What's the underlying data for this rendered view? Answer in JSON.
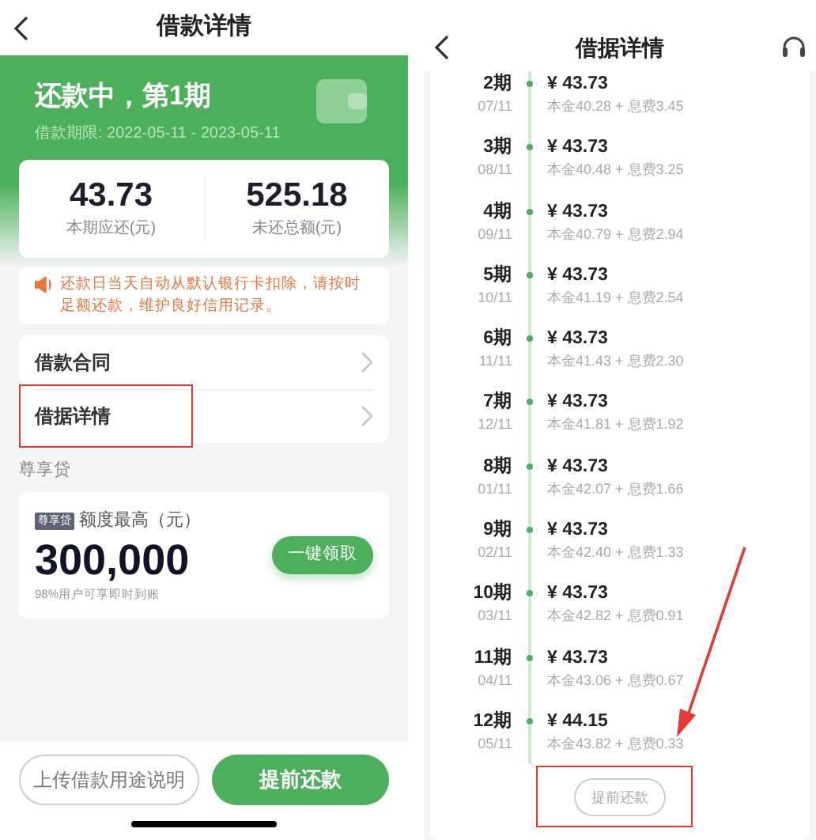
{
  "left": {
    "title": "借款详情",
    "status_title": "还款中，第1期",
    "loan_period": "借款期限: 2022-05-11 - 2023-05-11",
    "summary": [
      {
        "value": "43.73",
        "label": "本期应还(元)"
      },
      {
        "value": "525.18",
        "label": "未还总额(元)"
      }
    ],
    "notice": "还款日当天自动从默认银行卡扣除，请按时足额还款，维护良好信用记录。",
    "menu": [
      {
        "label": "借款合同"
      },
      {
        "label": "借据详情"
      }
    ],
    "section_title": "尊享贷",
    "promo": {
      "tag": "尊享贷",
      "label": "额度最高（元）",
      "amount": "300,000",
      "note": "98%用户可享即时到账",
      "button": "一键领取"
    },
    "buttons": [
      {
        "label": "上传借款用途说明",
        "kind": "outline"
      },
      {
        "label": "提前还款",
        "kind": "primary"
      }
    ]
  },
  "right": {
    "title": "借据详情",
    "installments": [
      {
        "period": "2期",
        "date": "07/11",
        "amount": "¥ 43.73",
        "breakdown": "本金40.28 + 息费3.45"
      },
      {
        "period": "3期",
        "date": "08/11",
        "amount": "¥ 43.73",
        "breakdown": "本金40.48 + 息费3.25"
      },
      {
        "period": "4期",
        "date": "09/11",
        "amount": "¥ 43.73",
        "breakdown": "本金40.79 + 息费2.94"
      },
      {
        "period": "5期",
        "date": "10/11",
        "amount": "¥ 43.73",
        "breakdown": "本金41.19 + 息费2.54"
      },
      {
        "period": "6期",
        "date": "11/11",
        "amount": "¥ 43.73",
        "breakdown": "本金41.43 + 息费2.30"
      },
      {
        "period": "7期",
        "date": "12/11",
        "amount": "¥ 43.73",
        "breakdown": "本金41.81 + 息费1.92"
      },
      {
        "period": "8期",
        "date": "01/11",
        "amount": "¥ 43.73",
        "breakdown": "本金42.07 + 息费1.66"
      },
      {
        "period": "9期",
        "date": "02/11",
        "amount": "¥ 43.73",
        "breakdown": "本金42.40 + 息费1.33"
      },
      {
        "period": "10期",
        "date": "03/11",
        "amount": "¥ 43.73",
        "breakdown": "本金42.82 + 息费0.91"
      },
      {
        "period": "11期",
        "date": "04/11",
        "amount": "¥ 43.73",
        "breakdown": "本金43.06 + 息费0.67"
      },
      {
        "period": "12期",
        "date": "05/11",
        "amount": "¥ 44.15",
        "breakdown": "本金43.82 + 息费0.33"
      }
    ],
    "button": "提前还款"
  }
}
